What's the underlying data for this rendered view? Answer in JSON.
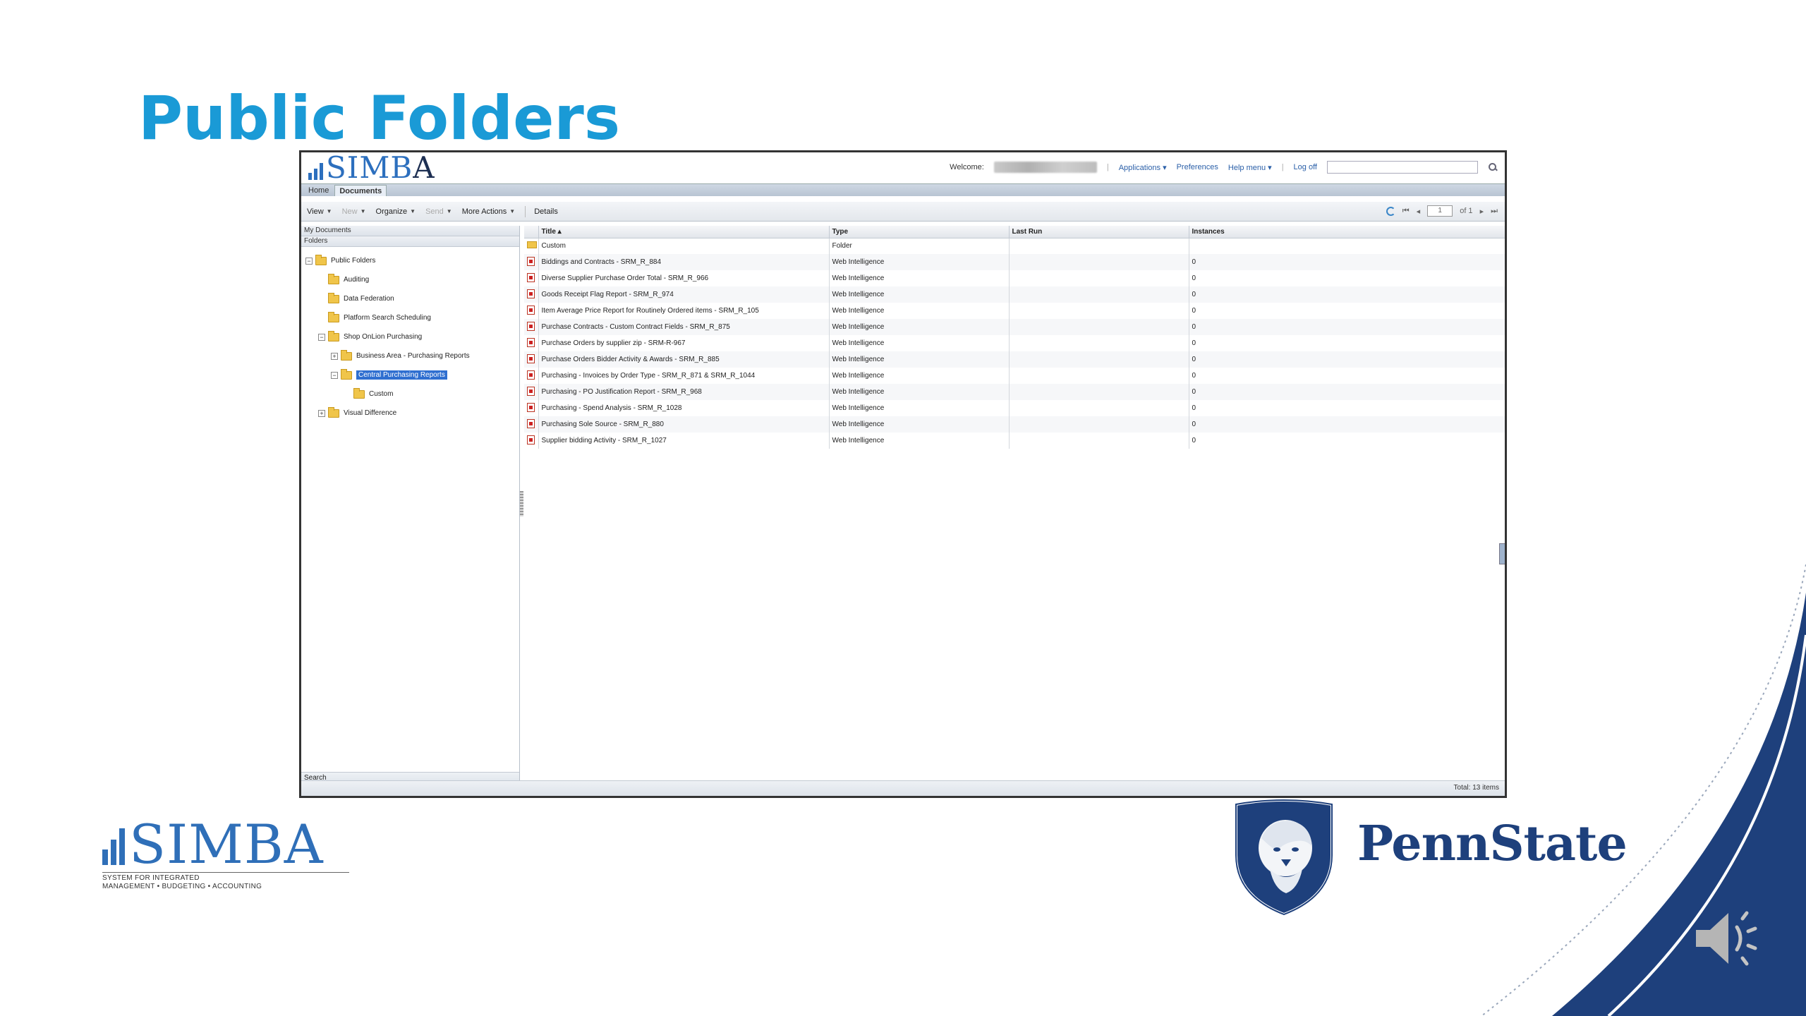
{
  "slide": {
    "title": "Public Folders"
  },
  "app": {
    "logo": {
      "text_blue": "SIMB",
      "text_dark": "A"
    },
    "header": {
      "welcome_label": "Welcome:",
      "links": [
        "Applications ▾",
        "Preferences",
        "Help menu ▾",
        "Log off"
      ],
      "search_placeholder": ""
    },
    "tabs": [
      "Home",
      "Documents"
    ],
    "active_tab": "Documents",
    "toolbar": {
      "items": [
        {
          "label": "View",
          "dropdown": true,
          "enabled": true
        },
        {
          "label": "New",
          "dropdown": true,
          "enabled": false
        },
        {
          "label": "Organize",
          "dropdown": true,
          "enabled": true
        },
        {
          "label": "Send",
          "dropdown": true,
          "enabled": false
        },
        {
          "label": "More Actions",
          "dropdown": true,
          "enabled": true
        },
        {
          "label": "Details",
          "dropdown": false,
          "enabled": true
        }
      ],
      "pager": {
        "current_page": "1",
        "of_label": "of 1"
      }
    },
    "left_pane": {
      "my_documents_label": "My Documents",
      "folders_label": "Folders",
      "search_label": "Search",
      "tree": [
        {
          "label": "Public Folders",
          "depth": 0,
          "expander": "−",
          "selected": false
        },
        {
          "label": "Auditing",
          "depth": 1,
          "expander": "",
          "selected": false
        },
        {
          "label": "Data Federation",
          "depth": 1,
          "expander": "",
          "selected": false
        },
        {
          "label": "Platform Search Scheduling",
          "depth": 1,
          "expander": "",
          "selected": false
        },
        {
          "label": "Shop OnLion Purchasing",
          "depth": 1,
          "expander": "−",
          "selected": false
        },
        {
          "label": "Business Area - Purchasing Reports",
          "depth": 2,
          "expander": "+",
          "selected": false
        },
        {
          "label": "Central Purchasing Reports",
          "depth": 2,
          "expander": "−",
          "selected": true
        },
        {
          "label": "Custom",
          "depth": 3,
          "expander": "",
          "selected": false
        },
        {
          "label": "Visual Difference",
          "depth": 1,
          "expander": "+",
          "selected": false
        }
      ]
    },
    "list": {
      "columns": [
        "Title ▴",
        "Type",
        "Last Run",
        "Instances"
      ],
      "rows": [
        {
          "icon": "folder",
          "title": "Custom",
          "type": "Folder",
          "last_run": "",
          "instances": ""
        },
        {
          "icon": "webi",
          "title": "Biddings and Contracts - SRM_R_884",
          "type": "Web Intelligence",
          "last_run": "",
          "instances": "0"
        },
        {
          "icon": "webi",
          "title": "Diverse Supplier Purchase Order Total - SRM_R_966",
          "type": "Web Intelligence",
          "last_run": "",
          "instances": "0"
        },
        {
          "icon": "webi",
          "title": "Goods Receipt Flag Report - SRM_R_974",
          "type": "Web Intelligence",
          "last_run": "",
          "instances": "0"
        },
        {
          "icon": "webi",
          "title": "Item Average Price Report for Routinely Ordered items - SRM_R_105",
          "type": "Web Intelligence",
          "last_run": "",
          "instances": "0"
        },
        {
          "icon": "webi",
          "title": "Purchase Contracts - Custom Contract Fields - SRM_R_875",
          "type": "Web Intelligence",
          "last_run": "",
          "instances": "0"
        },
        {
          "icon": "webi",
          "title": "Purchase Orders by supplier zip - SRM-R-967",
          "type": "Web Intelligence",
          "last_run": "",
          "instances": "0"
        },
        {
          "icon": "webi",
          "title": "Purchase Orders Bidder Activity & Awards - SRM_R_885",
          "type": "Web Intelligence",
          "last_run": "",
          "instances": "0"
        },
        {
          "icon": "webi",
          "title": "Purchasing - Invoices by Order Type - SRM_R_871 & SRM_R_1044",
          "type": "Web Intelligence",
          "last_run": "",
          "instances": "0"
        },
        {
          "icon": "webi",
          "title": "Purchasing - PO Justification Report - SRM_R_968",
          "type": "Web Intelligence",
          "last_run": "",
          "instances": "0"
        },
        {
          "icon": "webi",
          "title": "Purchasing - Spend Analysis - SRM_R_1028",
          "type": "Web Intelligence",
          "last_run": "",
          "instances": "0"
        },
        {
          "icon": "webi",
          "title": "Purchasing Sole Source - SRM_R_880",
          "type": "Web Intelligence",
          "last_run": "",
          "instances": "0"
        },
        {
          "icon": "webi",
          "title": "Supplier bidding Activity - SRM_R_1027",
          "type": "Web Intelligence",
          "last_run": "",
          "instances": "0"
        }
      ]
    },
    "status": {
      "total": "Total: 13 items"
    }
  },
  "footer": {
    "simba_logo": {
      "text": "SIMBA",
      "tagline_line1": "SYSTEM FOR INTEGRATED",
      "tagline_line2": "MANAGEMENT • BUDGETING • ACCOUNTING"
    },
    "pennstate_wordmark": "PennState",
    "speaker_icon": "speaker-audio-icon"
  },
  "colors": {
    "title_blue": "#1a9ad6",
    "psu_navy": "#1e407c",
    "selection_blue": "#2f6fd0"
  }
}
